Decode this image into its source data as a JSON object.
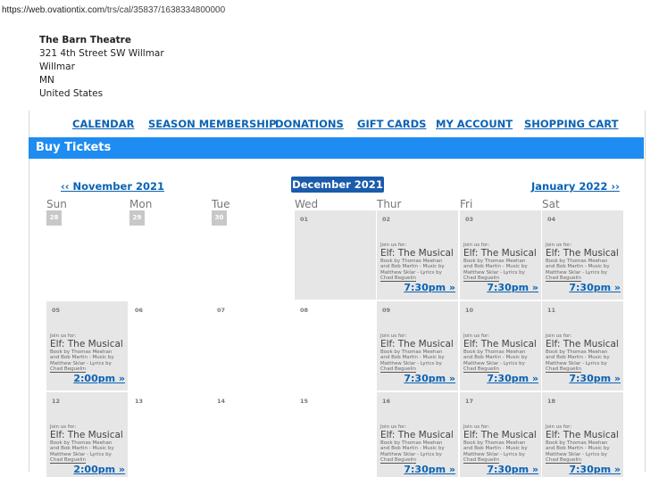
{
  "browser": {
    "url_host": "https://web.ovationtix.com",
    "url_path": "/trs/cal/35837/1638334800000"
  },
  "venue": {
    "name": "The Barn Theatre",
    "address1": "321 4th Street SW Willmar",
    "city": "Willmar",
    "state": "MN",
    "country": "United States"
  },
  "nav": [
    "CALENDAR",
    "SEASON MEMBERSHIP",
    "DONATIONS",
    "GIFT CARDS",
    "MY ACCOUNT",
    "SHOPPING CART"
  ],
  "section_title": "Buy Tickets",
  "calendar": {
    "prev_month": "‹‹ November 2021",
    "current_month": "December 2021 ⌄",
    "next_month": "January 2022 ››",
    "weekdays": [
      "Sun",
      "Mon",
      "Tue",
      "Wed",
      "Thur",
      "Fri",
      "Sat"
    ],
    "event": {
      "join": "Join us for:",
      "title": "Elf: The Musical",
      "credits": [
        "Book by Thomas Meehan",
        "and Bob Martin - Music by",
        "Matthew Sklar - Lyrics by",
        "Chad Beguelin"
      ]
    },
    "weeks": [
      [
        {
          "day": "28",
          "prev": true
        },
        {
          "day": "29",
          "prev": true
        },
        {
          "day": "30",
          "prev": true
        },
        {
          "day": "01"
        },
        {
          "day": "02",
          "time": "7:30pm »"
        },
        {
          "day": "03",
          "time": "7:30pm »"
        },
        {
          "day": "04",
          "time": "7:30pm »"
        }
      ],
      [
        {
          "day": "05",
          "time": "2:00pm »"
        },
        {
          "day": "06"
        },
        {
          "day": "07"
        },
        {
          "day": "08"
        },
        {
          "day": "09",
          "time": "7:30pm »"
        },
        {
          "day": "10",
          "time": "7:30pm »"
        },
        {
          "day": "11",
          "time": "7:30pm »"
        }
      ],
      [
        {
          "day": "12",
          "time": "2:00pm »"
        },
        {
          "day": "13"
        },
        {
          "day": "14"
        },
        {
          "day": "15"
        },
        {
          "day": "16",
          "time": "7:30pm »"
        },
        {
          "day": "17",
          "time": "7:30pm »"
        },
        {
          "day": "18",
          "time": "7:30pm »"
        }
      ]
    ]
  },
  "colors": {
    "accent_bar": "#1e8cf0",
    "link": "#0a63b5",
    "month_select": "#1a5bab",
    "cell_active": "#e6e6e6"
  }
}
